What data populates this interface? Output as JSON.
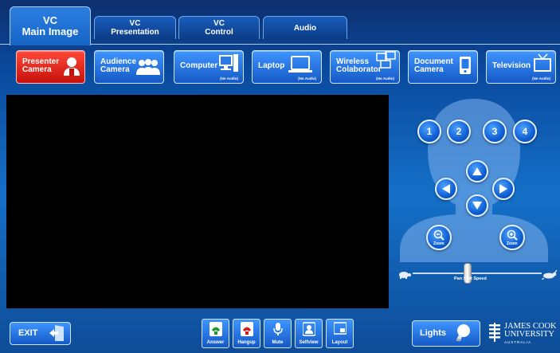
{
  "tabs": [
    {
      "line1": "VC",
      "line2": "Main Image",
      "active": true
    },
    {
      "line1": "VC",
      "line2": "Presentation",
      "active": false
    },
    {
      "line1": "VC",
      "line2": "Control",
      "active": false
    },
    {
      "line1": "",
      "line2": "Audio",
      "active": false
    }
  ],
  "sources": [
    {
      "line1": "Presenter",
      "line2": "Camera",
      "sub": "",
      "icon": "presenter-icon",
      "active": true
    },
    {
      "line1": "Audience",
      "line2": "Camera",
      "sub": "",
      "icon": "audience-icon",
      "active": false
    },
    {
      "line1": "Computer",
      "line2": "",
      "sub": "(No Audio)",
      "icon": "computer-icon",
      "active": false
    },
    {
      "line1": "Laptop",
      "line2": "",
      "sub": "(No Audio)",
      "icon": "laptop-icon",
      "active": false
    },
    {
      "line1": "Wireless",
      "line2": "Colaborator",
      "sub": "(No Audio)",
      "icon": "wireless-icon",
      "active": false
    },
    {
      "line1": "Document",
      "line2": "Camera",
      "sub": "",
      "icon": "document-camera-icon",
      "active": false
    },
    {
      "line1": "Television",
      "line2": "",
      "sub": "(No Audio)",
      "icon": "television-icon",
      "active": false
    }
  ],
  "camera": {
    "presets": [
      "1",
      "2",
      "3",
      "4"
    ],
    "zoom_out_label": "Zoom",
    "zoom_in_label": "Zoom",
    "speed_label": "Pan / Tilt Speed",
    "speed_value": 0.42
  },
  "bottom": {
    "exit_label": "EXIT",
    "controls": [
      {
        "label": "Answer",
        "icon": "phone-answer-icon"
      },
      {
        "label": "Hangup",
        "icon": "phone-hangup-icon"
      },
      {
        "label": "Mute",
        "icon": "microphone-icon"
      },
      {
        "label": "Selfview",
        "icon": "selfview-icon"
      },
      {
        "label": "Layout",
        "icon": "layout-icon"
      }
    ],
    "lights_label": "Lights"
  },
  "logo": {
    "line1": "JAMES COOK",
    "line2": "UNIVERSITY",
    "line3": "AUSTRALIA"
  },
  "colors": {
    "active_red": "#e0231a",
    "button_blue": "#2a7ae8",
    "background": "#0a4a9e"
  }
}
